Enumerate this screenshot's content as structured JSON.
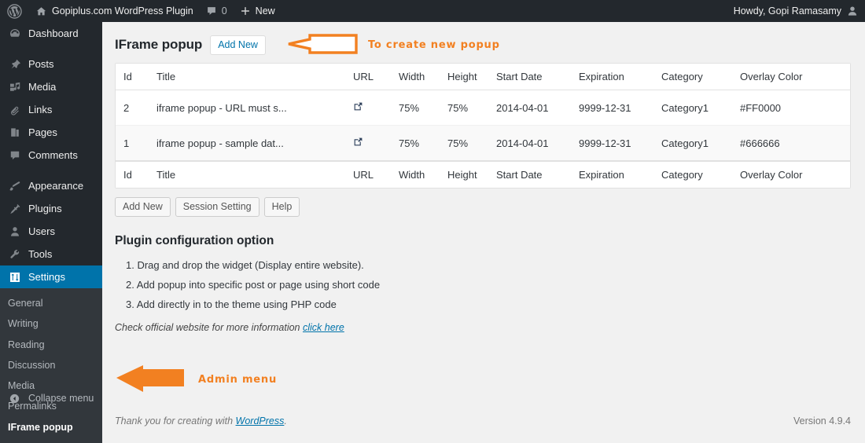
{
  "adminbar": {
    "site_name": "Gopiplus.com WordPress Plugin",
    "comment_count": "0",
    "new_label": "New",
    "howdy": "Howdy, Gopi Ramasamy",
    "icons": {
      "wp_logo": "wordpress-logo-icon",
      "home": "home-icon",
      "comment": "comment-bubble-icon",
      "plus": "plus-icon",
      "avatar": "user-avatar-icon"
    }
  },
  "sidebar": {
    "items": [
      {
        "label": "Dashboard",
        "icon": "dashboard-icon"
      },
      {
        "label": "Posts",
        "icon": "pin-icon"
      },
      {
        "label": "Media",
        "icon": "media-icon"
      },
      {
        "label": "Links",
        "icon": "paperclip-icon"
      },
      {
        "label": "Pages",
        "icon": "pages-icon"
      },
      {
        "label": "Comments",
        "icon": "comment-bubble-icon"
      },
      {
        "label": "Appearance",
        "icon": "brush-icon"
      },
      {
        "label": "Plugins",
        "icon": "plug-icon"
      },
      {
        "label": "Users",
        "icon": "user-icon"
      },
      {
        "label": "Tools",
        "icon": "wrench-icon"
      },
      {
        "label": "Settings",
        "icon": "settings-sliders-icon"
      }
    ],
    "submenu": [
      {
        "label": "General",
        "current": false
      },
      {
        "label": "Writing",
        "current": false
      },
      {
        "label": "Reading",
        "current": false
      },
      {
        "label": "Discussion",
        "current": false
      },
      {
        "label": "Media",
        "current": false
      },
      {
        "label": "Permalinks",
        "current": false
      },
      {
        "label": "IFrame popup",
        "current": true
      }
    ],
    "collapse_label": "Collapse menu",
    "collapse_icon": "collapse-arrow-icon",
    "current_item": "Settings",
    "accent_color": "#0073aa",
    "background_color": "#23282d"
  },
  "page": {
    "title": "IFrame popup",
    "add_new_label": "Add New"
  },
  "annotations": {
    "top": {
      "text": "To create new popup",
      "arrow": "arrow-left-outline-icon",
      "color": "#f28021"
    },
    "bottom": {
      "text": "Admin menu",
      "arrow": "arrow-left-filled-icon",
      "color": "#f28021"
    }
  },
  "table": {
    "columns": [
      "Id",
      "Title",
      "URL",
      "Width",
      "Height",
      "Start Date",
      "Expiration",
      "Category",
      "Overlay Color"
    ],
    "rows": [
      {
        "id": "2",
        "title": "iframe popup - URL must s...",
        "url_icon": "external-link-icon",
        "width": "75%",
        "height": "75%",
        "start_date": "2014-04-01",
        "expiration": "9999-12-31",
        "category": "Category1",
        "overlay_color": "#FF0000"
      },
      {
        "id": "1",
        "title": "iframe popup - sample dat...",
        "url_icon": "external-link-icon",
        "width": "75%",
        "height": "75%",
        "start_date": "2014-04-01",
        "expiration": "9999-12-31",
        "category": "Category1",
        "overlay_color": "#666666"
      }
    ]
  },
  "actions": {
    "add_new": "Add New",
    "session_setting": "Session Setting",
    "help": "Help"
  },
  "config": {
    "heading": "Plugin configuration option",
    "items": [
      "1. Drag and drop the widget (Display entire website).",
      "2. Add popup into specific post or page using short code",
      "3. Add directly in to the theme using PHP code"
    ],
    "note_prefix": "Check official website for more information ",
    "note_link": "click here"
  },
  "footer": {
    "thanks_prefix": "Thank you for creating with ",
    "thanks_link": "WordPress",
    "thanks_suffix": ".",
    "version": "Version 4.9.4"
  }
}
